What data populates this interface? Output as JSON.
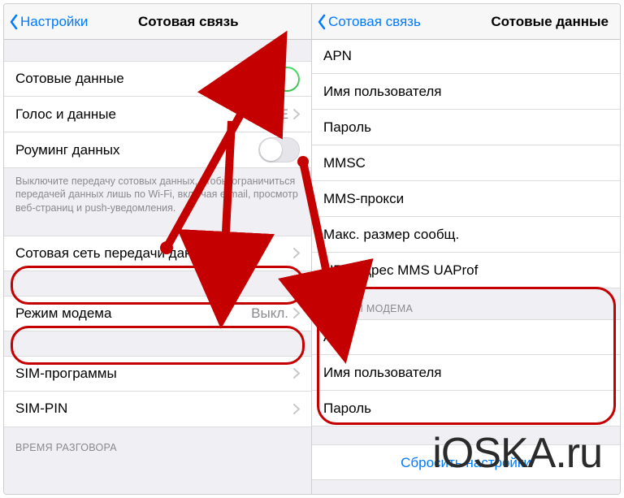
{
  "left": {
    "back": "Настройки",
    "title": "Сотовая связь",
    "cellular_data": "Сотовые данные",
    "voice_data": "Голос и данные",
    "voice_data_value": "LTE",
    "roaming": "Роуминг данных",
    "note": "Выключите передачу сотовых данных, чтобы ограничиться передачей данных лишь по Wi-Fi, включая e-mail, просмотр веб-страниц и push-уведомления.",
    "cdn": "Сотовая сеть передачи данных",
    "hotspot": "Режим модема",
    "hotspot_value": "Выкл.",
    "sim_apps": "SIM-программы",
    "sim_pin": "SIM-PIN",
    "call_time_header": "ВРЕМЯ РАЗГОВОРА"
  },
  "right": {
    "back": "Сотовая связь",
    "title": "Сотовые данные",
    "apn_top": "APN",
    "username": "Имя пользователя",
    "password": "Пароль",
    "mmsc": "MMSC",
    "mms_proxy": "MMS-прокси",
    "mms_max": "Макс. размер сообщ.",
    "mms_uaprof": "URL-адрес MMS UAProf",
    "section_modem": "РЕЖИМ МОДЕМА",
    "apn": "APN",
    "m_username": "Имя пользователя",
    "m_password": "Пароль",
    "reset": "Сбросить настройки"
  },
  "watermark": "iOSKA.ru"
}
